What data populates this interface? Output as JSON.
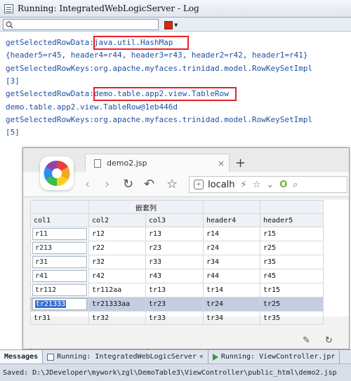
{
  "ide": {
    "title": "Running: IntegratedWebLogicServer - Log",
    "search_placeholder": "",
    "log_lines": [
      "getSelectedRowData:java.util.HashMap",
      "{header5=r45, header4=r44, header3=r43, header2=r42, header1=r41}",
      "getSelectedRowKeys:org.apache.myfaces.trinidad.model.RowKeySetImpl",
      "[3]",
      "getSelectedRowData:demo.table.app2.view.TableRow",
      "demo.table.app2.view.TableRow@1eb446d",
      "getSelectedRowKeys:org.apache.myfaces.trinidad.model.RowKeySetImpl",
      "[5]"
    ],
    "bottom_tabs": [
      "Messages",
      "Running: IntegratedWebLogicServer",
      "Running: ViewController.jpr"
    ],
    "status": "Saved: D:\\JDeveloper\\mywork\\zgl\\DemoTable3\\ViewController\\public_html\\demo2.jsp"
  },
  "browser": {
    "tab_title": "demo2.jsp",
    "url": "localh",
    "table": {
      "group_header": "嵌套列",
      "columns": [
        "col1",
        "col2",
        "col3",
        "header4",
        "header5"
      ],
      "rows": [
        [
          "r11",
          "r12",
          "r13",
          "r14",
          "r15"
        ],
        [
          "r213",
          "r22",
          "r23",
          "r24",
          "r25"
        ],
        [
          "r31",
          "r32",
          "r33",
          "r34",
          "r35"
        ],
        [
          "r41",
          "r42",
          "r43",
          "r44",
          "r45"
        ],
        [
          "tr112",
          "tr112aa",
          "tr13",
          "tr14",
          "tr15"
        ],
        [
          "tr21333",
          "tr21333aa",
          "tr23",
          "tr24",
          "tr25"
        ],
        [
          "tr31",
          "tr32",
          "tr33",
          "tr34",
          "tr35"
        ]
      ],
      "selected_row": 5
    }
  },
  "colors": {
    "log_text": "#1f4fa1",
    "highlight": "#e8202a",
    "selected_row": "#c3cee0"
  }
}
